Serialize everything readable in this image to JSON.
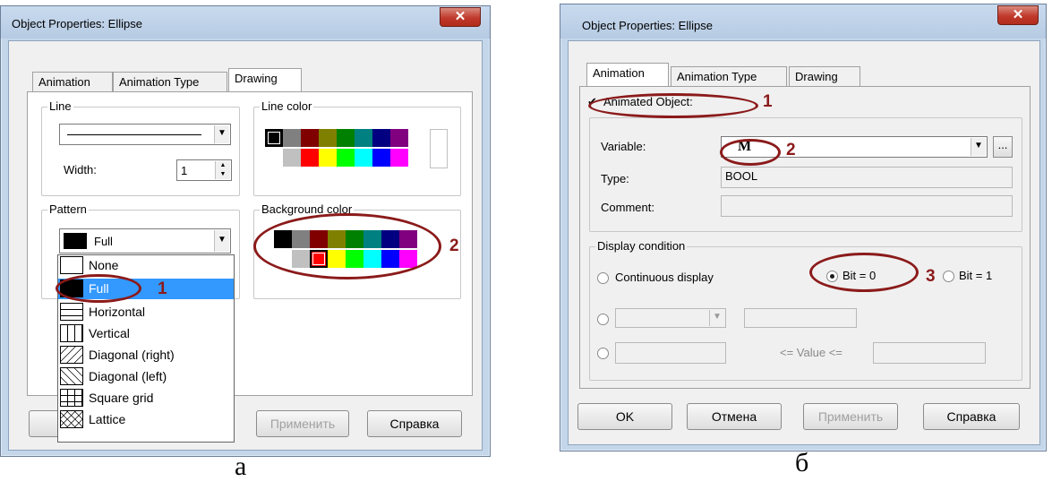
{
  "dialog_a": {
    "title": "Object Properties: Ellipse",
    "close_label": "✕",
    "tabs": [
      "Animation",
      "Animation Type",
      "Drawing"
    ],
    "active_tab": "Drawing",
    "line_group": "Line",
    "width_label": "Width:",
    "width_value": "1",
    "line_color_group": "Line color",
    "pattern_group": "Pattern",
    "pattern_selected": "Full",
    "background_color_group": "Background color",
    "pattern_options": [
      "None",
      "Full",
      "Horizontal",
      "Vertical",
      "Diagonal (right)",
      "Diagonal (left)",
      "Square grid",
      "Lattice"
    ],
    "apply_button": "Применить",
    "help_button": "Справка",
    "palette_top": [
      "#000000",
      "#808080",
      "#800000",
      "#808000",
      "#008000",
      "#008080",
      "#000080",
      "#800080"
    ],
    "palette_bottom": [
      "#ffffff",
      "#c0c0c0",
      "#ff0000",
      "#ffff00",
      "#00ff00",
      "#00ffff",
      "#0000ff",
      "#ff00ff"
    ],
    "annotation_1": "1",
    "annotation_2": "2",
    "caption": "а"
  },
  "dialog_b": {
    "title": "Object Properties: Ellipse",
    "close_label": "✕",
    "tabs": [
      "Animation",
      "Animation Type",
      "Drawing"
    ],
    "active_tab": "Animation",
    "animated_object_label": "Animated Object:",
    "animated_object_checked": true,
    "variable_label": "Variable:",
    "variable_value": "M",
    "browse_label": "...",
    "type_label": "Type:",
    "type_value": "BOOL",
    "comment_label": "Comment:",
    "display_condition_group": "Display condition",
    "continuous_display_label": "Continuous display",
    "bit0_label": "Bit = 0",
    "bit1_label": "Bit = 1",
    "value_range_label": "<= Value <=",
    "ok_button": "OK",
    "cancel_button": "Отмена",
    "apply_button": "Применить",
    "help_button": "Справка",
    "annotation_1": "1",
    "annotation_2": "2",
    "annotation_3": "3",
    "caption": "б"
  }
}
